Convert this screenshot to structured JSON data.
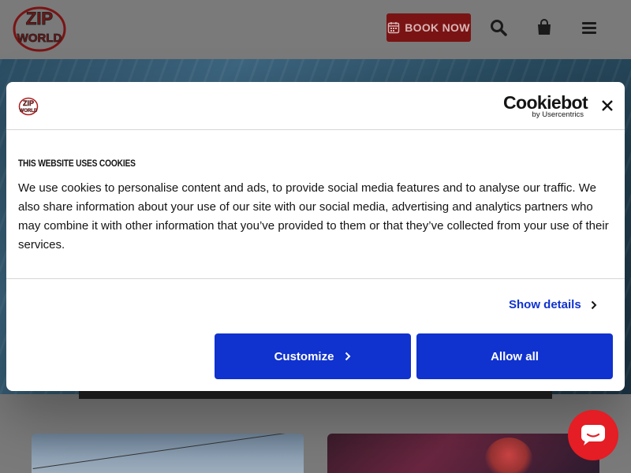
{
  "header": {
    "logo_text_top": "ZIP",
    "logo_text_bottom": "WORLD",
    "book_now_label": "BOOK NOW"
  },
  "icons": {
    "calendar": "calendar-icon",
    "search": "search-icon",
    "bag": "shopping-bag-icon",
    "menu": "hamburger-menu-icon",
    "close": "close-icon",
    "chevron": "chevron-right-icon",
    "chat": "chat-icon"
  },
  "cookie_dialog": {
    "brand": "Cookiebot",
    "brand_sub": "by Usercentrics",
    "title": "THIS WEBSITE USES COOKIES",
    "body": "We use cookies to personalise content and ads, to provide social media features and to analyse our traffic. We also share information about your use of our site with our social media, advertising and analytics partners who may combine it with other information that you’ve provided to them or that they’ve collected from your use of their services.",
    "show_details_label": "Show details",
    "customize_label": "Customize",
    "allow_all_label": "Allow all"
  },
  "colors": {
    "accent_blue": "#1032cf",
    "brand_red": "#e51d24",
    "book_button": "#7a1414"
  }
}
